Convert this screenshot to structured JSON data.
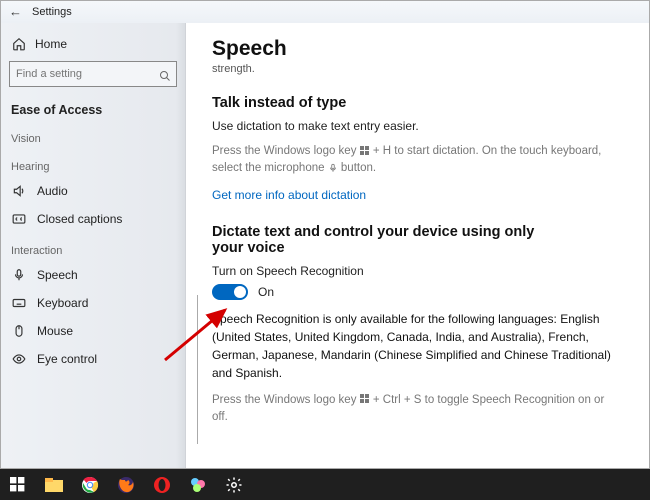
{
  "titlebar": {
    "title": "Settings"
  },
  "sidebar": {
    "home": "Home",
    "search_placeholder": "Find a setting",
    "section": "Ease of Access",
    "groups": {
      "g0": {
        "label": "Vision"
      },
      "g1": {
        "label": "Hearing",
        "items": {
          "i0": "Audio",
          "i1": "Closed captions"
        }
      },
      "g2": {
        "label": "Interaction",
        "items": {
          "i0": "Speech",
          "i1": "Keyboard",
          "i2": "Mouse",
          "i3": "Eye control"
        }
      }
    }
  },
  "main": {
    "title": "Speech",
    "subtitle": "strength.",
    "sec1": {
      "heading": "Talk instead of type",
      "line": "Use dictation to make text entry easier.",
      "hint_a": "Press the Windows logo key ",
      "hint_b": " + H to start dictation.  On the touch keyboard, select the microphone ",
      "hint_c": " button.",
      "link": "Get more info about dictation"
    },
    "sec2": {
      "heading": "Dictate text and control your device using only your voice",
      "toggle_label": "Turn on Speech Recognition",
      "toggle_state": "On",
      "para": "Speech Recognition is only available for the following languages: English (United States, United Kingdom, Canada, India, and Australia), French, German, Japanese, Mandarin (Chinese Simplified and Chinese Traditional) and Spanish.",
      "hint_a": "Press the Windows logo key ",
      "hint_b": " + Ctrl + S to toggle Speech Recognition on or off."
    }
  }
}
